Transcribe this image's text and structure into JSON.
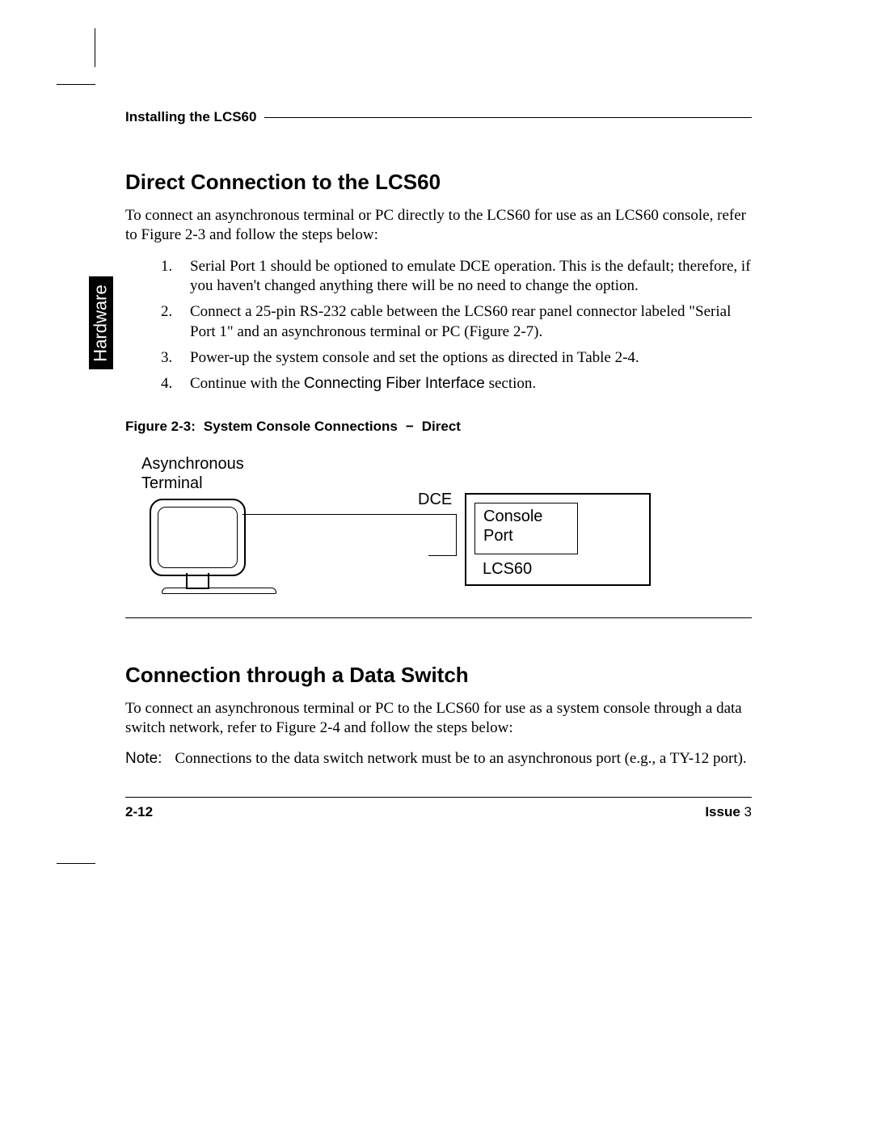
{
  "header": {
    "title": "Installing the LCS60"
  },
  "sidetab": "Hardware",
  "section1": {
    "heading": "Direct Connection to the LCS60",
    "intro": "To connect an asynchronous terminal or PC directly to the LCS60 for use as an LCS60 console, refer to Figure 2-3 and follow the steps below:",
    "steps": [
      "Serial Port 1 should be optioned to emulate DCE operation.  This is the default;  therefore, if you haven't changed anything there will be no need to change the option.",
      "Connect a 25-pin RS-232 cable between the LCS60 rear panel connector labeled \"Serial Port 1\" and an asynchronous terminal or PC (Figure 2-7).",
      "Power-up the system console and set the options as directed in Table 2-4.",
      "__step4__"
    ],
    "step4_prefix": "Continue with the ",
    "step4_ref": "Connecting Fiber Interface",
    "step4_suffix": " section."
  },
  "figure": {
    "number": "Figure 2-3:",
    "title": "System Console Connections",
    "dash": "−",
    "suffix": "Direct",
    "terminal_label": "Asynchronous\nTerminal",
    "dce": "DCE",
    "port_label": "Console\nPort",
    "device": "LCS60"
  },
  "section2": {
    "heading": "Connection through a Data Switch",
    "intro": "To connect an asynchronous terminal or PC to the LCS60 for use as a system console through a data switch network, refer to Figure 2-4 and follow the steps below:",
    "note_label": "Note:",
    "note_text": "Connections to the data switch network must be to an asynchronous port (e.g., a TY-12 port)."
  },
  "footer": {
    "page": "2-12",
    "issue_label": "Issue",
    "issue_num": "3"
  }
}
